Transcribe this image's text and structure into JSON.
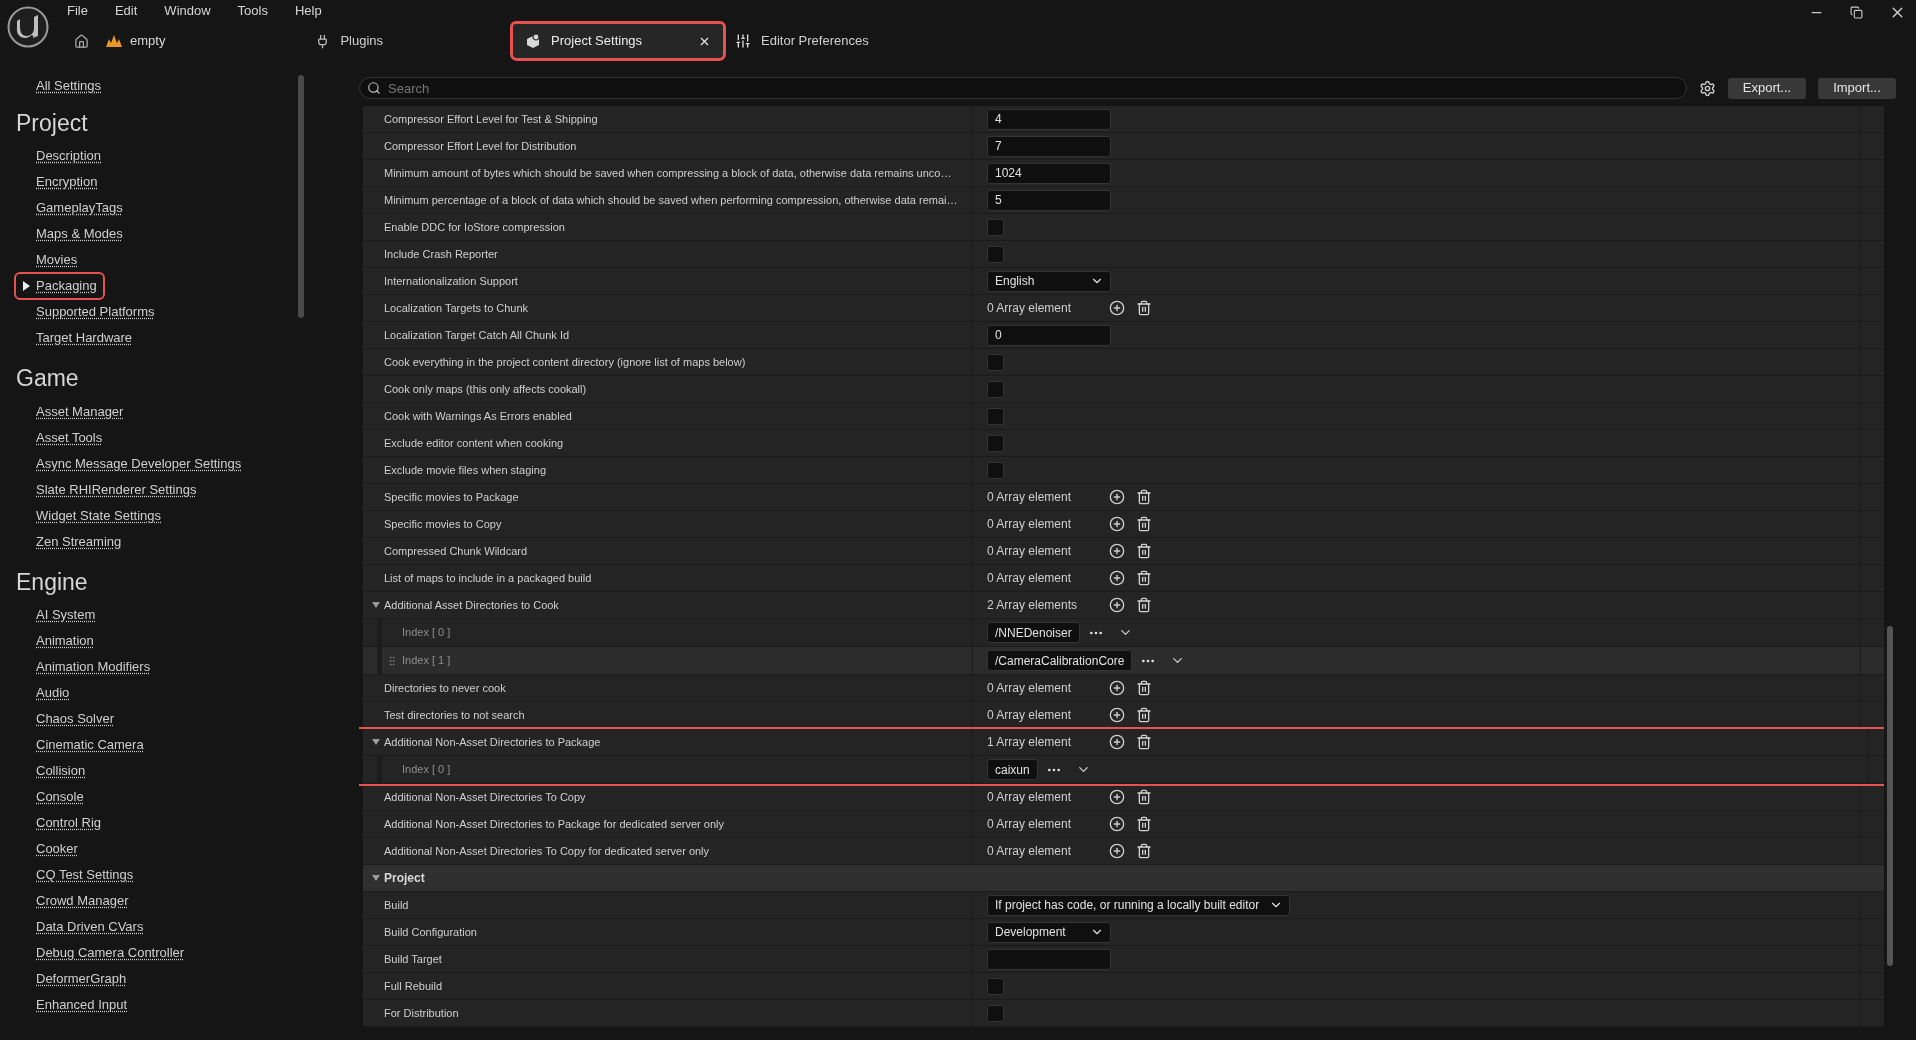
{
  "menu": [
    "File",
    "Edit",
    "Window",
    "Tools",
    "Help"
  ],
  "project_name": "empty",
  "tabs": [
    {
      "label": "Plugins",
      "selected": false,
      "highlighted": false,
      "kind": "plugins"
    },
    {
      "label": "Project Settings",
      "selected": true,
      "highlighted": true,
      "kind": "project"
    },
    {
      "label": "Editor Preferences",
      "selected": false,
      "highlighted": false,
      "kind": "editor"
    }
  ],
  "search": {
    "placeholder": "Search"
  },
  "buttons": [
    "Export...",
    "Import..."
  ],
  "sidebar": {
    "top_link": "All Settings",
    "sections": [
      {
        "title": "Project",
        "items": [
          {
            "label": "Description",
            "selected": false,
            "highlighted": false
          },
          {
            "label": "Encryption",
            "selected": false,
            "highlighted": false
          },
          {
            "label": "GameplayTags",
            "selected": false,
            "highlighted": false
          },
          {
            "label": "Maps & Modes",
            "selected": false,
            "highlighted": false
          },
          {
            "label": "Movies",
            "selected": false,
            "highlighted": false
          },
          {
            "label": "Packaging",
            "selected": true,
            "highlighted": true
          },
          {
            "label": "Supported Platforms",
            "selected": false,
            "highlighted": false
          },
          {
            "label": "Target Hardware",
            "selected": false,
            "highlighted": false
          }
        ]
      },
      {
        "title": "Game",
        "items": [
          {
            "label": "Asset Manager",
            "selected": false,
            "highlighted": false
          },
          {
            "label": "Asset Tools",
            "selected": false,
            "highlighted": false
          },
          {
            "label": "Async Message Developer Settings",
            "selected": false,
            "highlighted": false
          },
          {
            "label": "Slate RHIRenderer Settings",
            "selected": false,
            "highlighted": false
          },
          {
            "label": "Widget State Settings",
            "selected": false,
            "highlighted": false
          },
          {
            "label": "Zen Streaming",
            "selected": false,
            "highlighted": false
          }
        ]
      },
      {
        "title": "Engine",
        "items": [
          {
            "label": "AI System",
            "selected": false,
            "highlighted": false
          },
          {
            "label": "Animation",
            "selected": false,
            "highlighted": false
          },
          {
            "label": "Animation Modifiers",
            "selected": false,
            "highlighted": false
          },
          {
            "label": "Audio",
            "selected": false,
            "highlighted": false
          },
          {
            "label": "Chaos Solver",
            "selected": false,
            "highlighted": false
          },
          {
            "label": "Cinematic Camera",
            "selected": false,
            "highlighted": false
          },
          {
            "label": "Collision",
            "selected": false,
            "highlighted": false
          },
          {
            "label": "Console",
            "selected": false,
            "highlighted": false
          },
          {
            "label": "Control Rig",
            "selected": false,
            "highlighted": false
          },
          {
            "label": "Cooker",
            "selected": false,
            "highlighted": false
          },
          {
            "label": "CQ Test Settings",
            "selected": false,
            "highlighted": false
          },
          {
            "label": "Crowd Manager",
            "selected": false,
            "highlighted": false
          },
          {
            "label": "Data Driven CVars",
            "selected": false,
            "highlighted": false
          },
          {
            "label": "Debug Camera Controller",
            "selected": false,
            "highlighted": false
          },
          {
            "label": "DeformerGraph",
            "selected": false,
            "highlighted": false
          },
          {
            "label": "Enhanced Input",
            "selected": false,
            "highlighted": false
          }
        ]
      }
    ]
  },
  "settings": [
    {
      "kind": "number",
      "label": "Compressor Effort Level for Test & Shipping",
      "value": "4"
    },
    {
      "kind": "number",
      "label": "Compressor Effort Level for Distribution",
      "value": "7"
    },
    {
      "kind": "number",
      "label": "Minimum amount of bytes which should be saved when compressing a block of data, otherwise data remains unco…",
      "value": "1024"
    },
    {
      "kind": "number",
      "label": "Minimum percentage of a block of data which should be saved when performing compression, otherwise data remai…",
      "value": "5"
    },
    {
      "kind": "checkbox",
      "label": "Enable DDC for IoStore compression",
      "checked": false
    },
    {
      "kind": "checkbox",
      "label": "Include Crash Reporter",
      "checked": false
    },
    {
      "kind": "dropdown",
      "label": "Internationalization Support",
      "value": "English"
    },
    {
      "kind": "array",
      "label": "Localization Targets to Chunk",
      "count": "0 Array element"
    },
    {
      "kind": "number",
      "label": "Localization Target Catch All Chunk Id",
      "value": "0"
    },
    {
      "kind": "checkbox",
      "label": "Cook everything in the project content directory (ignore list of maps below)",
      "checked": false
    },
    {
      "kind": "checkbox",
      "label": "Cook only maps (this only affects cookall)",
      "checked": false
    },
    {
      "kind": "checkbox",
      "label": "Cook with Warnings As Errors enabled",
      "checked": false
    },
    {
      "kind": "checkbox",
      "label": "Exclude editor content when cooking",
      "checked": false
    },
    {
      "kind": "checkbox",
      "label": "Exclude movie files when staging",
      "checked": false
    },
    {
      "kind": "array",
      "label": "Specific movies to Package",
      "count": "0 Array element"
    },
    {
      "kind": "array",
      "label": "Specific movies to Copy",
      "count": "0 Array element"
    },
    {
      "kind": "array",
      "label": "Compressed Chunk Wildcard",
      "count": "0 Array element"
    },
    {
      "kind": "array",
      "label": "List of maps to include in a packaged build",
      "count": "0 Array element"
    },
    {
      "kind": "array",
      "label": "Additional Asset Directories to Cook",
      "count": "2 Array elements",
      "expanded": true,
      "highlighted": false,
      "children": [
        {
          "label": "Index [ 0 ]",
          "value": "/NNEDenoiser",
          "hovered": false
        },
        {
          "label": "Index [ 1 ]",
          "value": "/CameraCalibrationCore",
          "hovered": true
        }
      ]
    },
    {
      "kind": "array",
      "label": "Directories to never cook",
      "count": "0 Array element"
    },
    {
      "kind": "array",
      "label": "Test directories to not search",
      "count": "0 Array element"
    },
    {
      "kind": "array",
      "label": "Additional Non-Asset Directories to Package",
      "count": "1 Array element",
      "expanded": true,
      "highlighted": true,
      "children": [
        {
          "label": "Index [ 0 ]",
          "value": "caixun",
          "hovered": false
        }
      ]
    },
    {
      "kind": "array",
      "label": "Additional Non-Asset Directories To Copy",
      "count": "0 Array element"
    },
    {
      "kind": "array",
      "label": "Additional Non-Asset Directories to Package for dedicated server only",
      "count": "0 Array element"
    },
    {
      "kind": "array",
      "label": "Additional Non-Asset Directories To Copy for dedicated server only",
      "count": "0 Array element"
    },
    {
      "kind": "category",
      "label": "Project",
      "expanded": true,
      "children": [
        {
          "kind": "dropdown",
          "label": "Build",
          "value": "If project has code, or running a locally built editor"
        },
        {
          "kind": "dropdown",
          "label": "Build Configuration",
          "value": "Development"
        },
        {
          "kind": "text",
          "label": "Build Target"
        },
        {
          "kind": "checkbox",
          "label": "Full Rebuild",
          "checked": false
        },
        {
          "kind": "checkbox",
          "label": "For Distribution",
          "checked": false
        }
      ]
    }
  ]
}
